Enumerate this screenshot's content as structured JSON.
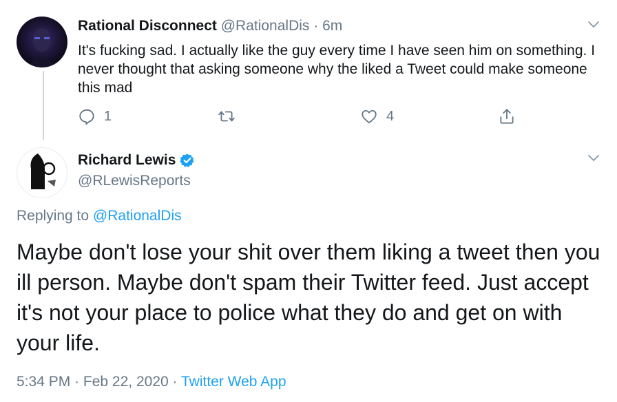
{
  "parent_tweet": {
    "display_name": "Rational Disconnect",
    "handle": "@RationalDis",
    "separator": "·",
    "time": "6m",
    "text": "It's fucking sad. I actually like the guy every time I have seen him on something. I never thought that asking someone why the liked a Tweet could make someone this mad",
    "reply_count": "1",
    "like_count": "4"
  },
  "main_tweet": {
    "display_name": "Richard Lewis",
    "handle": "@RLewisReports",
    "replying_prefix": "Replying to",
    "replying_handle": "@RationalDis",
    "text": "Maybe don't lose your shit over them liking a tweet then you ill person. Maybe don't spam their Twitter feed. Just accept it's not your place to police what they do and get on with your life.",
    "time": "5:34 PM",
    "date_sep": "·",
    "date": "Feb 22, 2020",
    "source_sep": "·",
    "source": "Twitter Web App"
  },
  "icons": {
    "reply": "reply-icon",
    "retweet": "retweet-icon",
    "like": "heart-icon",
    "share": "share-icon",
    "more": "chevron-down-icon",
    "verified": "verified-badge-icon"
  },
  "colors": {
    "accent": "#1da1f2",
    "secondary_text": "#657786",
    "primary_text": "#14171a"
  }
}
